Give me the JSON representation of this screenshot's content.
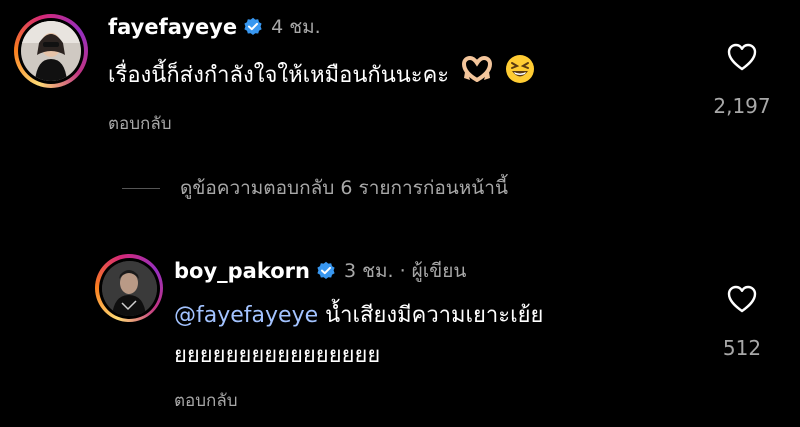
{
  "comments": [
    {
      "username": "fayefayeye",
      "verified": true,
      "time": "4 ชม.",
      "text": "เรื่องนี้ก็ส่งกำลังใจให้เหมือนกันนะคะ",
      "emojis": [
        "heart-hands-emoji",
        "grinning-squinting-face-emoji"
      ],
      "reply_label": "ตอบกลับ",
      "likes": "2,197"
    }
  ],
  "view_replies": "ดูข้อความตอบกลับ 6 รายการก่อนหน้านี้",
  "reply": {
    "username": "boy_pakorn",
    "verified": true,
    "time": "3 ชม.",
    "separator": "·",
    "author_badge": "ผู้เขียน",
    "mention": "@fayefayeye",
    "text_line1": "น้ำเสียงมีความเยาะเย้ย",
    "text_line2": "ยยยยยยยยยยยยยยยย",
    "reply_label": "ตอบกลับ",
    "likes": "512"
  },
  "colors": {
    "background": "#000000",
    "secondary_text": "#a8a8a8",
    "verified_blue": "#3897f0",
    "mention_blue": "#a3c3ff"
  }
}
